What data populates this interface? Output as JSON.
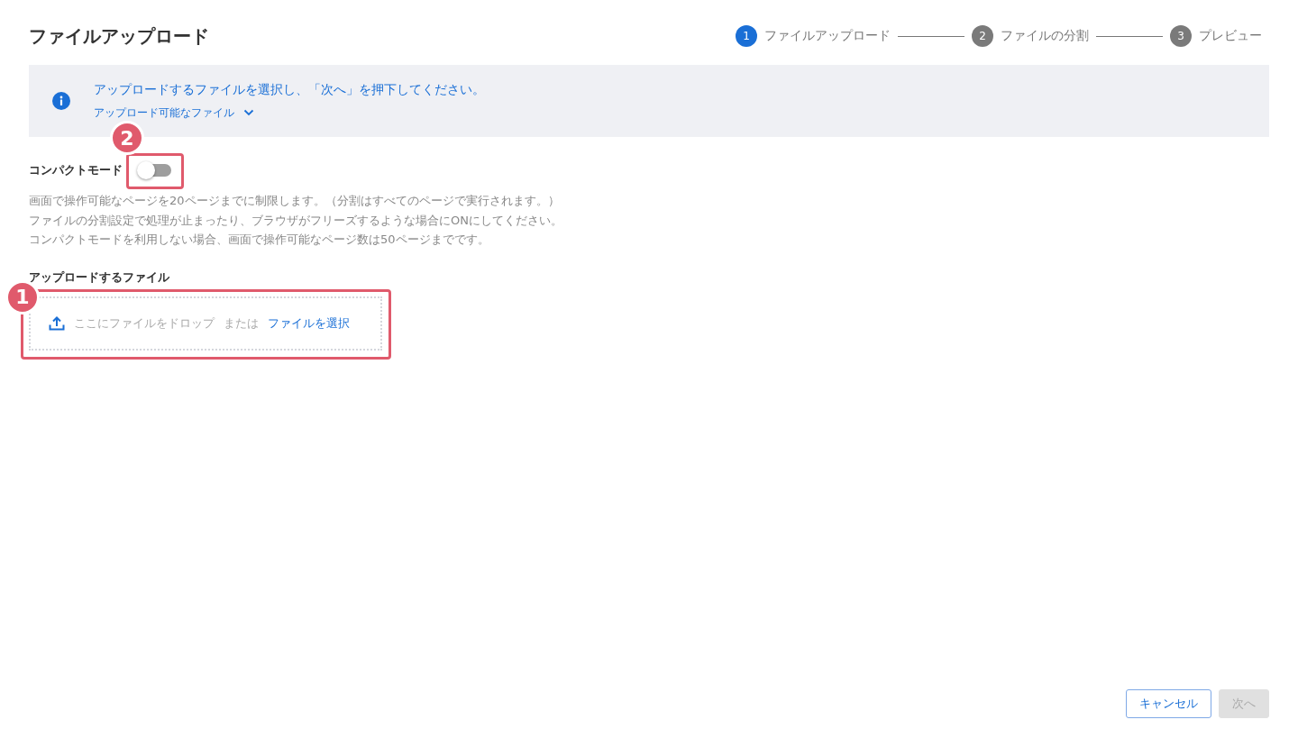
{
  "title": "ファイルアップロード",
  "steps": [
    {
      "number": "1",
      "label": "ファイルアップロード",
      "selected": true
    },
    {
      "number": "2",
      "label": "ファイルの分割",
      "selected": false
    },
    {
      "number": "3",
      "label": "プレビュー",
      "selected": false
    }
  ],
  "info": {
    "message": "アップロードするファイルを選択し、「次へ」を押下してください。",
    "expander": {
      "label": "アップロード可能なファイル",
      "expanded": false
    }
  },
  "compact_mode": {
    "label": "コンパクトモード",
    "on": false,
    "annotation": "2",
    "description": [
      "画面で操作可能なページを20ページまでに制限します。（分割はすべてのページで実行されます。）",
      "ファイルの分割設定で処理が止まったり、ブラウザがフリーズするような場合にONにしてください。",
      "コンパクトモードを利用しない場合、画面で操作可能なページ数は50ページまでです。"
    ]
  },
  "upload": {
    "label": "アップロードするファイル",
    "annotation": "1",
    "drop_text": "ここにファイルをドロップ",
    "or_text": "または",
    "select_link": "ファイルを選択"
  },
  "buttons": [
    {
      "label": "キャンセル",
      "kind": "secondary",
      "disabled": false
    },
    {
      "label": "次へ",
      "kind": "primary",
      "disabled": true
    }
  ]
}
